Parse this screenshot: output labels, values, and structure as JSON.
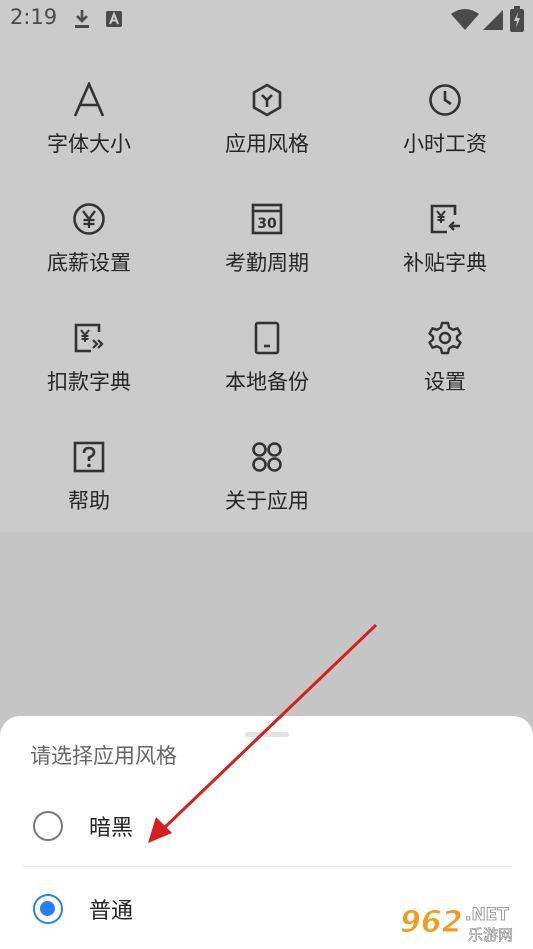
{
  "status_bar": {
    "time": "2:19",
    "icons": [
      "download-icon",
      "font-app-icon",
      "wifi-icon",
      "signal-icon",
      "battery-icon"
    ]
  },
  "grid": {
    "items": [
      {
        "label": "字体大小",
        "icon": "font-size-icon"
      },
      {
        "label": "应用风格",
        "icon": "hexagon-style-icon"
      },
      {
        "label": "小时工资",
        "icon": "clock-icon"
      },
      {
        "label": "底薪设置",
        "icon": "yen-circle-icon"
      },
      {
        "label": "考勤周期",
        "icon": "calendar-30-icon"
      },
      {
        "label": "补贴字典",
        "icon": "yen-card-in-icon"
      },
      {
        "label": "扣款字典",
        "icon": "yen-card-out-icon"
      },
      {
        "label": "本地备份",
        "icon": "tablet-icon"
      },
      {
        "label": "设置",
        "icon": "gear-icon"
      },
      {
        "label": "帮助",
        "icon": "question-icon"
      },
      {
        "label": "关于应用",
        "icon": "four-dots-icon"
      }
    ]
  },
  "sheet": {
    "title": "请选择应用风格",
    "options": [
      {
        "label": "暗黑",
        "selected": false
      },
      {
        "label": "普通",
        "selected": true
      }
    ]
  },
  "watermark": {
    "brand": "962",
    "suffix": ".NET",
    "sub": "乐游网"
  },
  "colors": {
    "accent": "#2a7ff0",
    "arrow": "#d61f1f",
    "watermark_orange": "#f29a1b"
  }
}
